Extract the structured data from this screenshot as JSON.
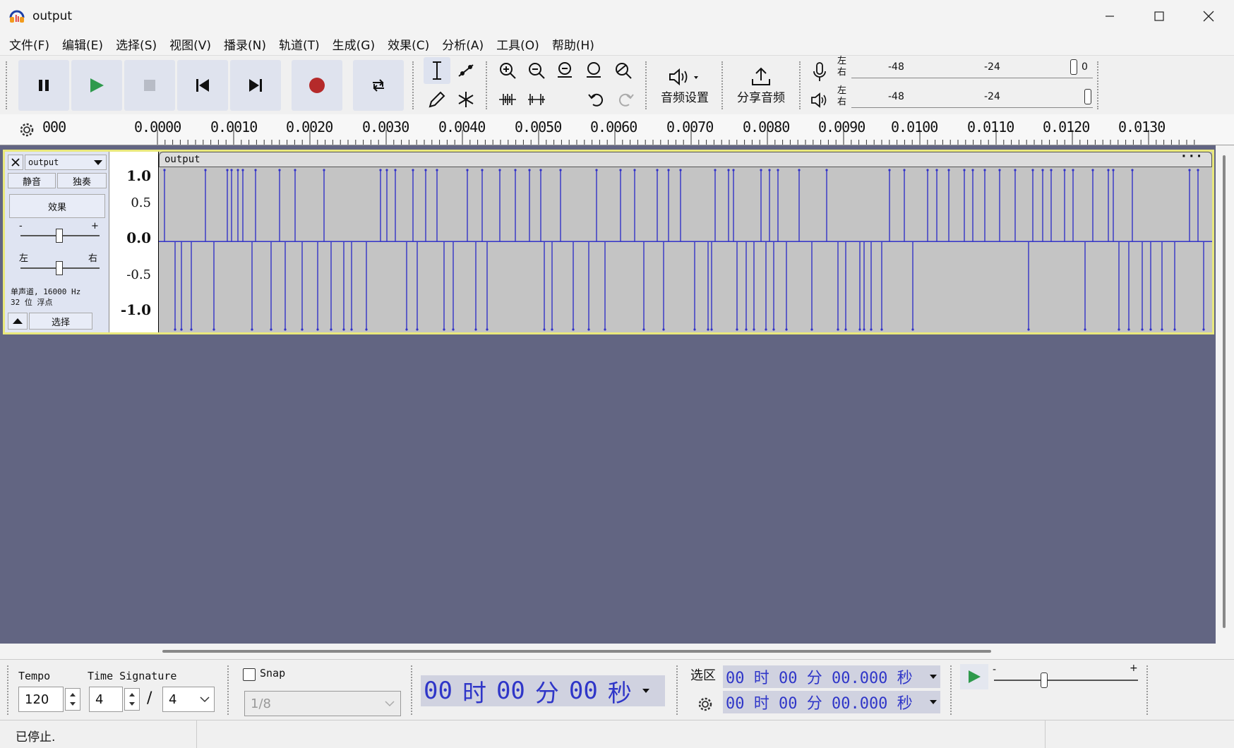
{
  "window": {
    "title": "output",
    "minimize_icon": "minimize-icon",
    "maximize_icon": "maximize-icon",
    "close_icon": "close-icon"
  },
  "menu": [
    "文件(F)",
    "编辑(E)",
    "选择(S)",
    "视图(V)",
    "播录(N)",
    "轨道(T)",
    "生成(G)",
    "效果(C)",
    "分析(A)",
    "工具(O)",
    "帮助(H)"
  ],
  "toolbar": {
    "audio_setup_label": "音频设置",
    "share_label": "分享音频",
    "meter_left": "左",
    "meter_right": "右",
    "meter_ticks": [
      "-48",
      "-24",
      "0"
    ]
  },
  "ruler": {
    "labels": [
      "000",
      "0.0000",
      "0.0010",
      "0.0020",
      "0.0030",
      "0.0040",
      "0.0050",
      "0.0060",
      "0.0070",
      "0.0080",
      "0.0090",
      "0.0100",
      "0.0110",
      "0.0120",
      "0.0130"
    ]
  },
  "track": {
    "name": "output",
    "mute": "静音",
    "solo": "独奏",
    "effects": "效果",
    "gain_minus": "-",
    "gain_plus": "+",
    "pan_left": "左",
    "pan_right": "右",
    "info_line1": "单声道, 16000 Hz",
    "info_line2": "32 位 浮点",
    "select": "选择",
    "clip_name": "output",
    "scale": [
      "1.0",
      "0.5",
      "0.0",
      "-0.5",
      "-1.0"
    ],
    "wave_color": "#3232c8"
  },
  "bottom": {
    "tempo_label": "Tempo",
    "tempo_value": "120",
    "timesig_label": "Time Signature",
    "timesig_num": "4",
    "timesig_slash": "/",
    "timesig_den": "4",
    "snap_label": "Snap",
    "snap_value": "1/8",
    "time_display": [
      "00",
      "时",
      "00",
      "分",
      "00",
      "秒"
    ],
    "selection_label": "选区",
    "sel_start": "00 时 00 分 00.000 秒",
    "sel_end": "00 时 00 分 00.000 秒",
    "speed_minus": "-",
    "speed_plus": "+"
  },
  "status": {
    "text": "已停止."
  }
}
